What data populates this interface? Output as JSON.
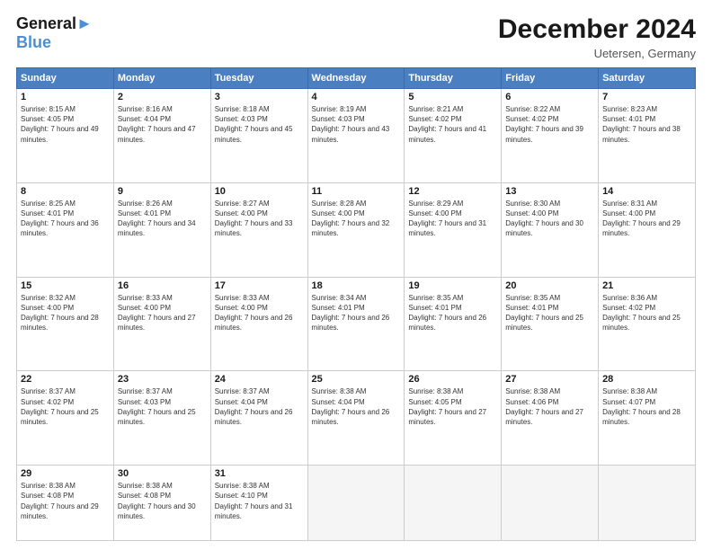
{
  "header": {
    "logo_line1": "General",
    "logo_line2": "Blue",
    "month": "December 2024",
    "location": "Uetersen, Germany"
  },
  "weekdays": [
    "Sunday",
    "Monday",
    "Tuesday",
    "Wednesday",
    "Thursday",
    "Friday",
    "Saturday"
  ],
  "weeks": [
    [
      {
        "day": "1",
        "sunrise": "Sunrise: 8:15 AM",
        "sunset": "Sunset: 4:05 PM",
        "daylight": "Daylight: 7 hours and 49 minutes."
      },
      {
        "day": "2",
        "sunrise": "Sunrise: 8:16 AM",
        "sunset": "Sunset: 4:04 PM",
        "daylight": "Daylight: 7 hours and 47 minutes."
      },
      {
        "day": "3",
        "sunrise": "Sunrise: 8:18 AM",
        "sunset": "Sunset: 4:03 PM",
        "daylight": "Daylight: 7 hours and 45 minutes."
      },
      {
        "day": "4",
        "sunrise": "Sunrise: 8:19 AM",
        "sunset": "Sunset: 4:03 PM",
        "daylight": "Daylight: 7 hours and 43 minutes."
      },
      {
        "day": "5",
        "sunrise": "Sunrise: 8:21 AM",
        "sunset": "Sunset: 4:02 PM",
        "daylight": "Daylight: 7 hours and 41 minutes."
      },
      {
        "day": "6",
        "sunrise": "Sunrise: 8:22 AM",
        "sunset": "Sunset: 4:02 PM",
        "daylight": "Daylight: 7 hours and 39 minutes."
      },
      {
        "day": "7",
        "sunrise": "Sunrise: 8:23 AM",
        "sunset": "Sunset: 4:01 PM",
        "daylight": "Daylight: 7 hours and 38 minutes."
      }
    ],
    [
      {
        "day": "8",
        "sunrise": "Sunrise: 8:25 AM",
        "sunset": "Sunset: 4:01 PM",
        "daylight": "Daylight: 7 hours and 36 minutes."
      },
      {
        "day": "9",
        "sunrise": "Sunrise: 8:26 AM",
        "sunset": "Sunset: 4:01 PM",
        "daylight": "Daylight: 7 hours and 34 minutes."
      },
      {
        "day": "10",
        "sunrise": "Sunrise: 8:27 AM",
        "sunset": "Sunset: 4:00 PM",
        "daylight": "Daylight: 7 hours and 33 minutes."
      },
      {
        "day": "11",
        "sunrise": "Sunrise: 8:28 AM",
        "sunset": "Sunset: 4:00 PM",
        "daylight": "Daylight: 7 hours and 32 minutes."
      },
      {
        "day": "12",
        "sunrise": "Sunrise: 8:29 AM",
        "sunset": "Sunset: 4:00 PM",
        "daylight": "Daylight: 7 hours and 31 minutes."
      },
      {
        "day": "13",
        "sunrise": "Sunrise: 8:30 AM",
        "sunset": "Sunset: 4:00 PM",
        "daylight": "Daylight: 7 hours and 30 minutes."
      },
      {
        "day": "14",
        "sunrise": "Sunrise: 8:31 AM",
        "sunset": "Sunset: 4:00 PM",
        "daylight": "Daylight: 7 hours and 29 minutes."
      }
    ],
    [
      {
        "day": "15",
        "sunrise": "Sunrise: 8:32 AM",
        "sunset": "Sunset: 4:00 PM",
        "daylight": "Daylight: 7 hours and 28 minutes."
      },
      {
        "day": "16",
        "sunrise": "Sunrise: 8:33 AM",
        "sunset": "Sunset: 4:00 PM",
        "daylight": "Daylight: 7 hours and 27 minutes."
      },
      {
        "day": "17",
        "sunrise": "Sunrise: 8:33 AM",
        "sunset": "Sunset: 4:00 PM",
        "daylight": "Daylight: 7 hours and 26 minutes."
      },
      {
        "day": "18",
        "sunrise": "Sunrise: 8:34 AM",
        "sunset": "Sunset: 4:01 PM",
        "daylight": "Daylight: 7 hours and 26 minutes."
      },
      {
        "day": "19",
        "sunrise": "Sunrise: 8:35 AM",
        "sunset": "Sunset: 4:01 PM",
        "daylight": "Daylight: 7 hours and 26 minutes."
      },
      {
        "day": "20",
        "sunrise": "Sunrise: 8:35 AM",
        "sunset": "Sunset: 4:01 PM",
        "daylight": "Daylight: 7 hours and 25 minutes."
      },
      {
        "day": "21",
        "sunrise": "Sunrise: 8:36 AM",
        "sunset": "Sunset: 4:02 PM",
        "daylight": "Daylight: 7 hours and 25 minutes."
      }
    ],
    [
      {
        "day": "22",
        "sunrise": "Sunrise: 8:37 AM",
        "sunset": "Sunset: 4:02 PM",
        "daylight": "Daylight: 7 hours and 25 minutes."
      },
      {
        "day": "23",
        "sunrise": "Sunrise: 8:37 AM",
        "sunset": "Sunset: 4:03 PM",
        "daylight": "Daylight: 7 hours and 25 minutes."
      },
      {
        "day": "24",
        "sunrise": "Sunrise: 8:37 AM",
        "sunset": "Sunset: 4:04 PM",
        "daylight": "Daylight: 7 hours and 26 minutes."
      },
      {
        "day": "25",
        "sunrise": "Sunrise: 8:38 AM",
        "sunset": "Sunset: 4:04 PM",
        "daylight": "Daylight: 7 hours and 26 minutes."
      },
      {
        "day": "26",
        "sunrise": "Sunrise: 8:38 AM",
        "sunset": "Sunset: 4:05 PM",
        "daylight": "Daylight: 7 hours and 27 minutes."
      },
      {
        "day": "27",
        "sunrise": "Sunrise: 8:38 AM",
        "sunset": "Sunset: 4:06 PM",
        "daylight": "Daylight: 7 hours and 27 minutes."
      },
      {
        "day": "28",
        "sunrise": "Sunrise: 8:38 AM",
        "sunset": "Sunset: 4:07 PM",
        "daylight": "Daylight: 7 hours and 28 minutes."
      }
    ],
    [
      {
        "day": "29",
        "sunrise": "Sunrise: 8:38 AM",
        "sunset": "Sunset: 4:08 PM",
        "daylight": "Daylight: 7 hours and 29 minutes."
      },
      {
        "day": "30",
        "sunrise": "Sunrise: 8:38 AM",
        "sunset": "Sunset: 4:08 PM",
        "daylight": "Daylight: 7 hours and 30 minutes."
      },
      {
        "day": "31",
        "sunrise": "Sunrise: 8:38 AM",
        "sunset": "Sunset: 4:10 PM",
        "daylight": "Daylight: 7 hours and 31 minutes."
      },
      null,
      null,
      null,
      null
    ]
  ]
}
